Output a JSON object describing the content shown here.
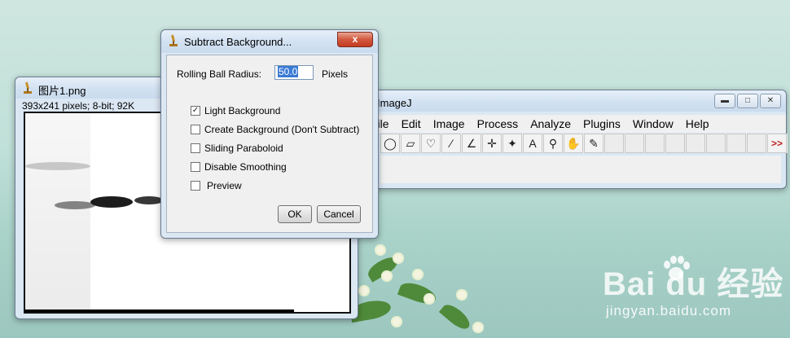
{
  "dialog": {
    "title": "Subtract Background...",
    "close_label": "x",
    "radius_label": "Rolling Ball Radius:",
    "radius_value": "50.0",
    "radius_units": "Pixels",
    "options": [
      {
        "label": "Light Background",
        "checked": true
      },
      {
        "label": "Create Background (Don't Subtract)",
        "checked": false
      },
      {
        "label": "Sliding Paraboloid",
        "checked": false
      },
      {
        "label": "Disable Smoothing",
        "checked": false
      },
      {
        "label": "Preview",
        "checked": false
      }
    ],
    "ok_label": "OK",
    "cancel_label": "Cancel"
  },
  "image_window": {
    "title": "图片1.png",
    "info": "393x241 pixels; 8-bit; 92K"
  },
  "imagej": {
    "title": "ImageJ",
    "menus": [
      "File",
      "Edit",
      "Image",
      "Process",
      "Analyze",
      "Plugins",
      "Window",
      "Help"
    ],
    "more_tools": ">>"
  },
  "watermark": {
    "main": "Bai  du 经验",
    "sub": "jingyan.baidu.com"
  }
}
